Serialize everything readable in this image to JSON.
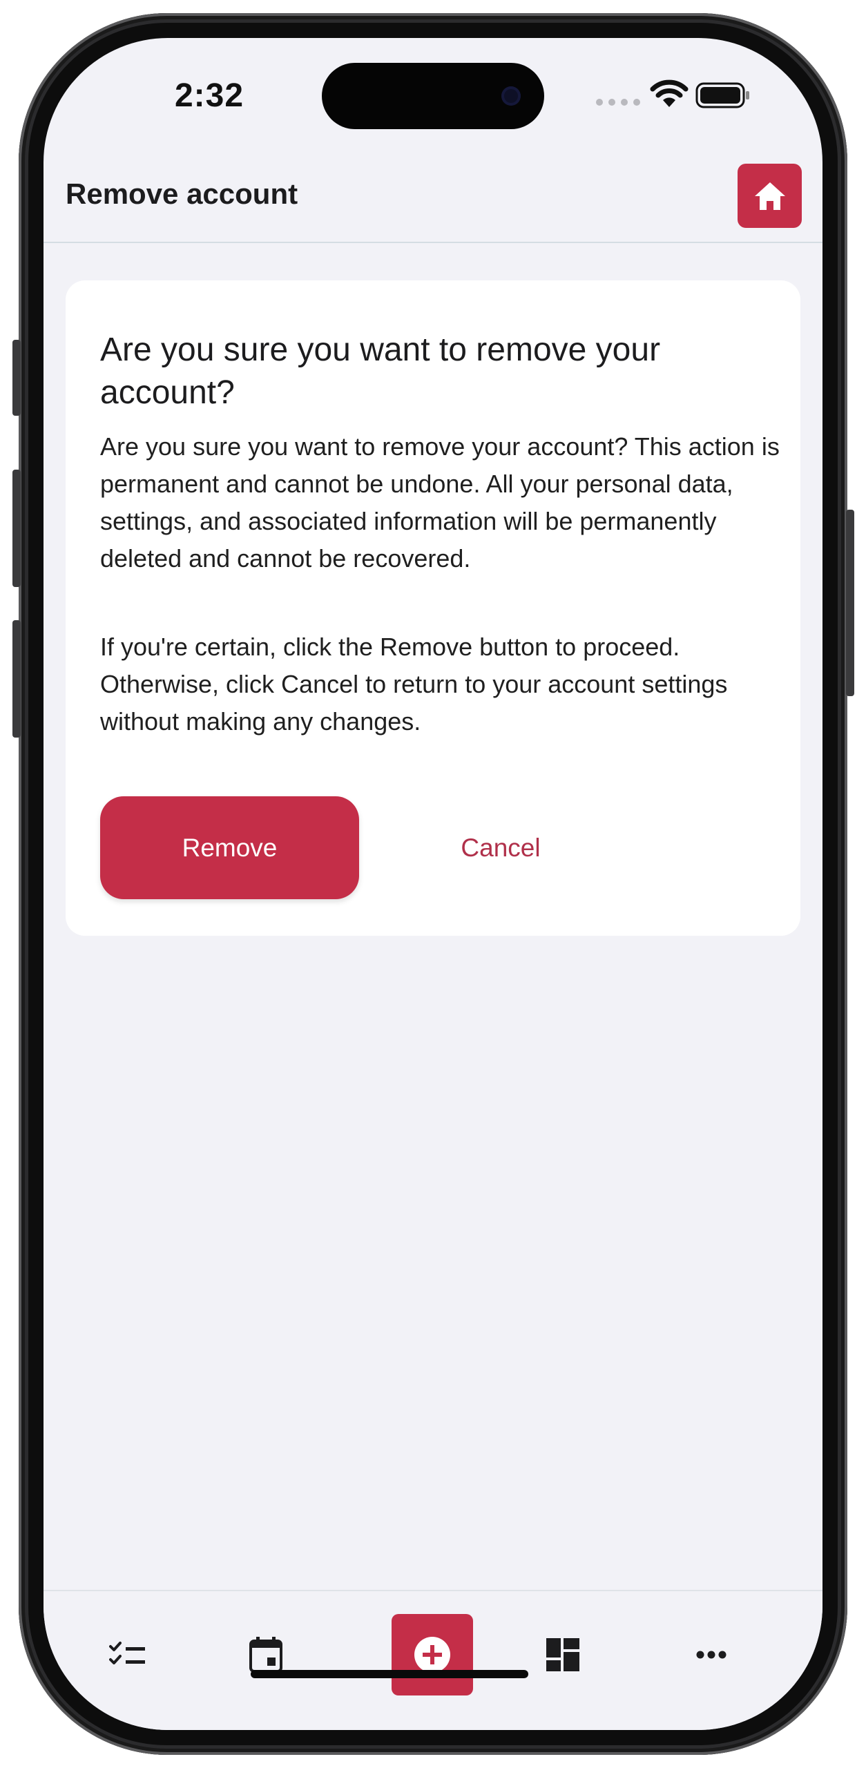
{
  "status_bar": {
    "time": "2:32"
  },
  "header": {
    "title": "Remove account",
    "home_icon": "home-icon"
  },
  "dialog": {
    "heading": "Are you sure you want to remove your account?",
    "paragraph_1": "Are you sure you want to remove your account? This action is permanent and cannot be undone. All your personal data, settings, and associated information will be permanently deleted and cannot be recovered.",
    "paragraph_2": "If you're certain, click the Remove button to proceed. Otherwise, click Cancel to return to your account settings without making any changes.",
    "remove_label": "Remove",
    "cancel_label": "Cancel"
  },
  "bottom_nav": {
    "items": [
      {
        "icon": "checklist-icon"
      },
      {
        "icon": "calendar-icon"
      },
      {
        "icon": "add-icon"
      },
      {
        "icon": "dashboard-icon"
      },
      {
        "icon": "more-icon"
      }
    ]
  },
  "colors": {
    "accent": "#c42e48",
    "background": "#f2f2f7",
    "card": "#ffffff",
    "cancel_text": "#b0304a"
  }
}
